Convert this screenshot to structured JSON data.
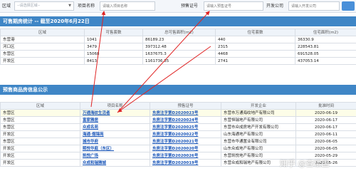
{
  "search": {
    "region_label": "区域",
    "region_placeholder": "--请选择区域--",
    "project_label": "项目名称",
    "project_placeholder": "请输入项目名称",
    "permit_label": "预售证号",
    "permit_placeholder": "请输入预售证号",
    "developer_label": "开发公司",
    "developer_placeholder": "请输入开发公司"
  },
  "stats": {
    "title": "可售期房统计 -- 截至2020年6月22日",
    "headers": [
      "区域",
      "可售套数",
      "总可售面积(m2)",
      "住宅套数",
      "住宅面积(m2)"
    ],
    "rows": [
      [
        "东营港",
        "1041",
        "86189.23",
        "440",
        "36330.9"
      ],
      [
        "河口区",
        "3479",
        "397312.48",
        "2315",
        "228543.81"
      ],
      [
        "东营区",
        "15068",
        "1637675.3",
        "4468",
        "691528.05"
      ],
      [
        "开发区",
        "8413",
        "1161736.35",
        "2741",
        "437053.14"
      ]
    ]
  },
  "presale": {
    "title": "预售商品房信息公示",
    "headers": [
      "区域",
      "项目名称",
      "预售证号",
      "开发企业",
      "批准时间"
    ],
    "rows": [
      [
        "东营区",
        "万通海纹生活者",
        "东房注字第D2020023号",
        "东营市万通海纹地产有限公司",
        "2020-06-19"
      ],
      [
        "东营区",
        "富家雅居",
        "东房注字第D2020024号",
        "东营恒瑞地产有限公司",
        "2020-06-17"
      ],
      [
        "东营区",
        "众成名苑",
        "东房注字第D2020025号",
        "东营市众成房地产开发有限公司",
        "2020-06-17"
      ],
      [
        "开发区",
        "海通·煜锦苑",
        "东房注字第D2020022号",
        "山东海通地产有限公司",
        "2020-06-11"
      ],
      [
        "东营区",
        "城市华府",
        "东房注字第D2020021号",
        "东营市华通置业有限公司",
        "2020-06-05"
      ],
      [
        "开发区",
        "熙悦华庭（东区）",
        "东房注字第D2020020号",
        "山东众成地产有限公司",
        "2020-06-05"
      ],
      [
        "开发区",
        "凯悦广场",
        "东房注字第D2020026号",
        "东营凯悦地产有限公司",
        "2020-05-29"
      ],
      [
        "开发区",
        "众成和瑞雅城",
        "东房注字第D2020019号",
        "东营众成和瑞地产有限公司",
        "2020-05-26"
      ]
    ]
  },
  "watermark": "知乎 @查楼盘"
}
